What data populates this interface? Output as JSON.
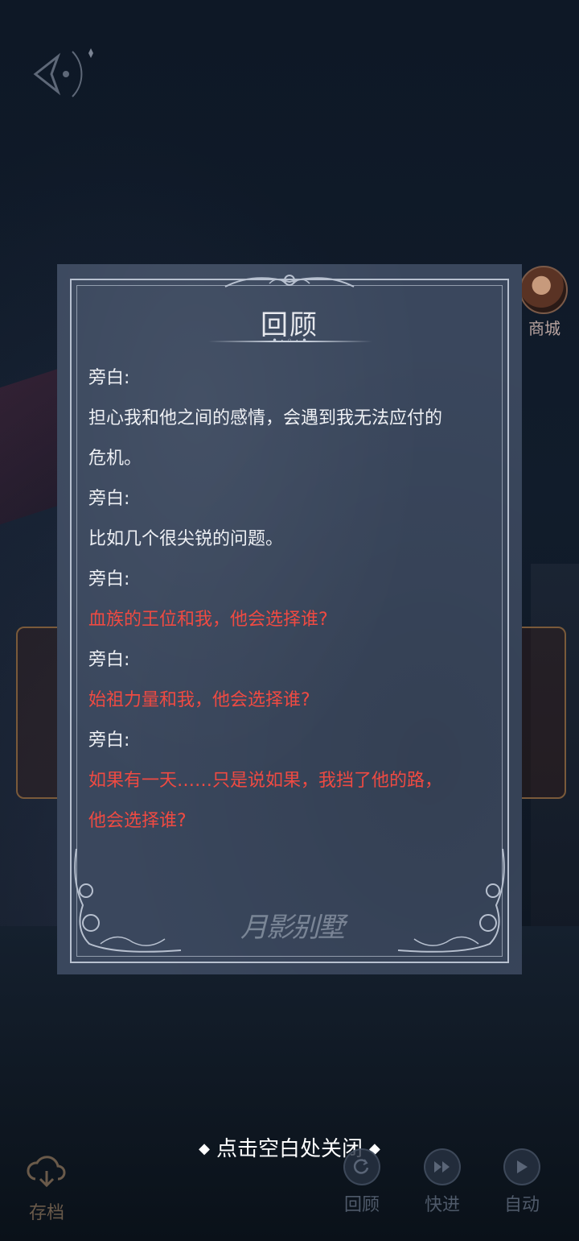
{
  "panel": {
    "title": "回顾",
    "watermark": "月影别墅",
    "entries": [
      {
        "text": "旁白:",
        "color": "white"
      },
      {
        "text": "担心我和他之间的感情，会遇到我无法应付的",
        "color": "white"
      },
      {
        "text": "危机。",
        "color": "white"
      },
      {
        "text": "旁白:",
        "color": "white"
      },
      {
        "text": "比如几个很尖锐的问题。",
        "color": "white"
      },
      {
        "text": "旁白:",
        "color": "white"
      },
      {
        "text": "血族的王位和我，他会选择谁?",
        "color": "red"
      },
      {
        "text": "旁白:",
        "color": "white"
      },
      {
        "text": "始祖力量和我，他会选择谁?",
        "color": "red"
      },
      {
        "text": "旁白:",
        "color": "white"
      },
      {
        "text": "如果有一天……只是说如果，我挡了他的路，",
        "color": "red"
      },
      {
        "text": "他会选择谁?",
        "color": "red"
      }
    ]
  },
  "shop": {
    "label": "商城"
  },
  "close_hint": "点击空白处关闭",
  "toolbar": {
    "save": "存档",
    "review": "回顾",
    "fast_forward": "快进",
    "auto": "自动"
  },
  "colors": {
    "panel_bg": "#3a475d",
    "highlight_red": "#ef4a42",
    "text_white": "#eef0f4"
  },
  "icons": [
    "back-icon",
    "cloud-save-icon",
    "review-icon",
    "fast-forward-icon",
    "play-icon"
  ]
}
